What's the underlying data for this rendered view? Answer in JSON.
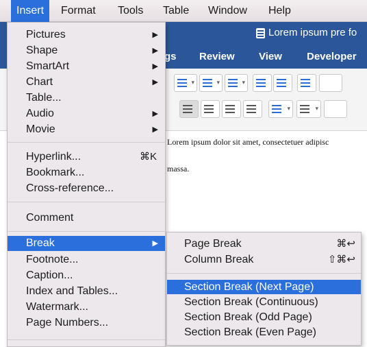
{
  "menubar": {
    "items": [
      {
        "label": "Insert",
        "active": true
      },
      {
        "label": "Format"
      },
      {
        "label": "Tools"
      },
      {
        "label": "Table"
      },
      {
        "label": "Window"
      },
      {
        "label": "Help"
      }
    ]
  },
  "app": {
    "doc_title": "Lorem ipsum pre fo",
    "ribbon_tabs": [
      "gs",
      "Review",
      "View",
      "Developer"
    ],
    "document_text": [
      "Lorem ipsum dolor sit amet, consectetuer adipisc",
      "massa."
    ]
  },
  "insert_menu": {
    "items": [
      {
        "label": "Pictures",
        "submenu": true
      },
      {
        "label": "Shape",
        "submenu": true
      },
      {
        "label": "SmartArt",
        "submenu": true
      },
      {
        "label": "Chart",
        "submenu": true
      },
      {
        "label": "Table..."
      },
      {
        "label": "Audio",
        "submenu": true
      },
      {
        "label": "Movie",
        "submenu": true
      },
      {
        "label": "Hyperlink...",
        "shortcut": "⌘K"
      },
      {
        "label": "Bookmark..."
      },
      {
        "label": "Cross-reference..."
      },
      {
        "label": "Comment"
      },
      {
        "label": "Break",
        "submenu": true,
        "highlighted": true
      },
      {
        "label": "Footnote..."
      },
      {
        "label": "Caption..."
      },
      {
        "label": "Index and Tables..."
      },
      {
        "label": "Watermark..."
      },
      {
        "label": "Page Numbers..."
      }
    ],
    "arrow_glyph": "▶"
  },
  "break_submenu": {
    "items": [
      {
        "label": "Page Break",
        "shortcut": "⌘↩"
      },
      {
        "label": "Column Break",
        "shortcut": "⇧⌘↩"
      },
      {
        "label": "Section Break (Next Page)",
        "highlighted": true
      },
      {
        "label": "Section Break (Continuous)"
      },
      {
        "label": "Section Break (Odd Page)"
      },
      {
        "label": "Section Break (Even Page)"
      }
    ]
  },
  "colors": {
    "accent": "#2a6fdc",
    "ribbon": "#2b579a",
    "menu_bg": "#ece8eb"
  }
}
